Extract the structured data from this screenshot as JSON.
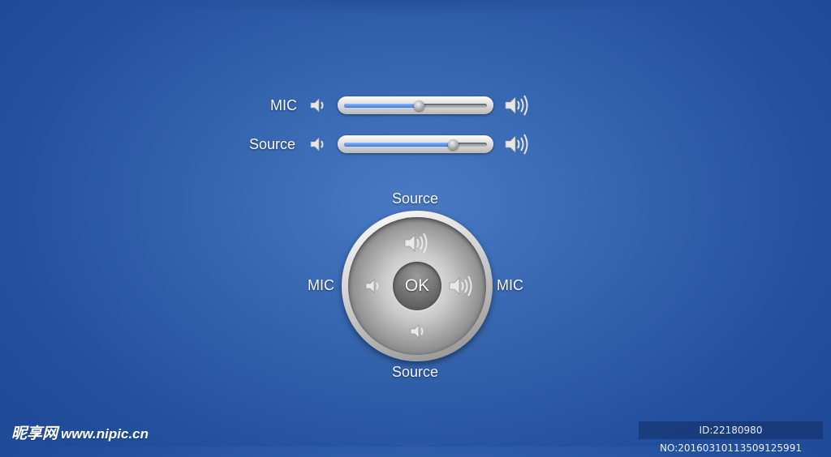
{
  "sliders": [
    {
      "label": "MIC",
      "value": 0.52,
      "low_icon": "speaker-low-icon",
      "high_icon": "speaker-high-icon"
    },
    {
      "label": "Source",
      "value": 0.76,
      "low_icon": "speaker-low-icon",
      "high_icon": "speaker-high-icon"
    }
  ],
  "dial": {
    "top_label": "Source",
    "bottom_label": "Source",
    "left_label": "MIC",
    "right_label": "MIC",
    "center_label": "OK",
    "top_icon": "speaker-high-icon",
    "bottom_icon": "speaker-low-icon",
    "left_icon": "speaker-low-icon",
    "right_icon": "speaker-high-icon"
  },
  "colors": {
    "background": "#3463ad",
    "slider_fill": "#3f78e0"
  },
  "watermark": {
    "logo_text": "昵享网",
    "url": "www.nipic.cn",
    "id_text": "ID:22180980 NO:20160310113509125991"
  }
}
